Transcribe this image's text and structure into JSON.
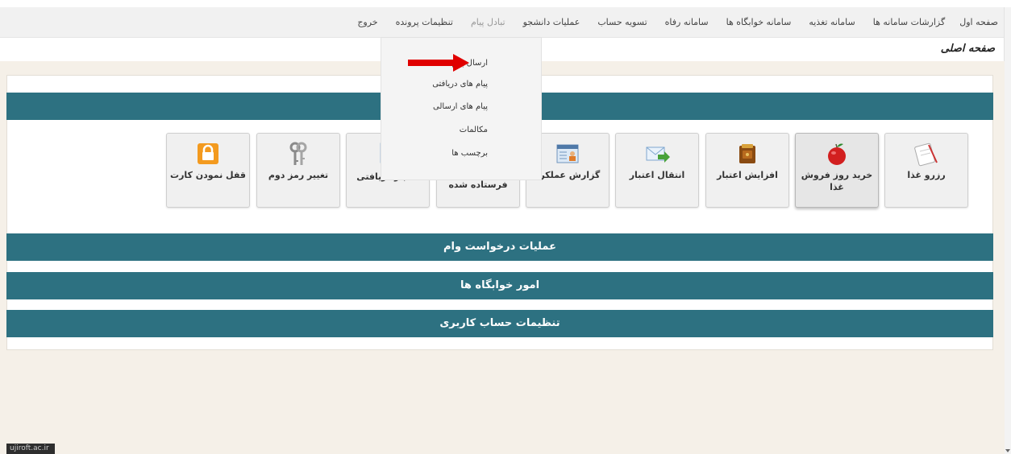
{
  "nav": {
    "items": [
      {
        "label": "صفحه اول"
      },
      {
        "label": "گزارشات سامانه ها"
      },
      {
        "label": "سامانه تغذیه"
      },
      {
        "label": "سامانه خوابگاه ها"
      },
      {
        "label": "سامانه رفاه"
      },
      {
        "label": "تسویه حساب"
      },
      {
        "label": "عملیات دانشجو"
      },
      {
        "label": "تبادل پیام"
      },
      {
        "label": "تنظیمات پرونده"
      },
      {
        "label": "خروج"
      }
    ]
  },
  "page": {
    "title": "صفحه اصلی"
  },
  "dropdown": {
    "items": [
      {
        "label": "ارسال پیام"
      },
      {
        "label": "پیام های دریافتی"
      },
      {
        "label": "پیام های ارسالی"
      },
      {
        "label": "مکالمات"
      },
      {
        "label": "برچسب ها"
      }
    ]
  },
  "cards": [
    {
      "label": "رزرو غذا",
      "icon": "food-reservation-icon"
    },
    {
      "label": "خرید روز فروش غذا",
      "icon": "apple-icon"
    },
    {
      "label": "افزایش اعتبار",
      "icon": "wallet-icon"
    },
    {
      "label": "انتقال اعتبار",
      "icon": "mail-transfer-icon"
    },
    {
      "label": "گزارش عملکرد",
      "icon": "report-card-icon"
    },
    {
      "label": "فرستاده شده",
      "icon": "sent-credit-icon"
    },
    {
      "label": "اعتبار دریافتی",
      "icon": "received-credit-icon"
    },
    {
      "label": "تغییر رمز دوم",
      "icon": "keys-icon"
    },
    {
      "label": "قفل نمودن کارت",
      "icon": "lock-icon"
    }
  ],
  "sections": [
    {
      "label": "عملیات درخواست وام"
    },
    {
      "label": "امور خوابگاه ها"
    },
    {
      "label": "تنظیمات حساب کاربری"
    }
  ],
  "footer": {
    "text": "ujiroft.ac.ir"
  },
  "colors": {
    "teal": "#2d7181",
    "beige": "#f5f0e8",
    "arrow": "#e00000"
  }
}
